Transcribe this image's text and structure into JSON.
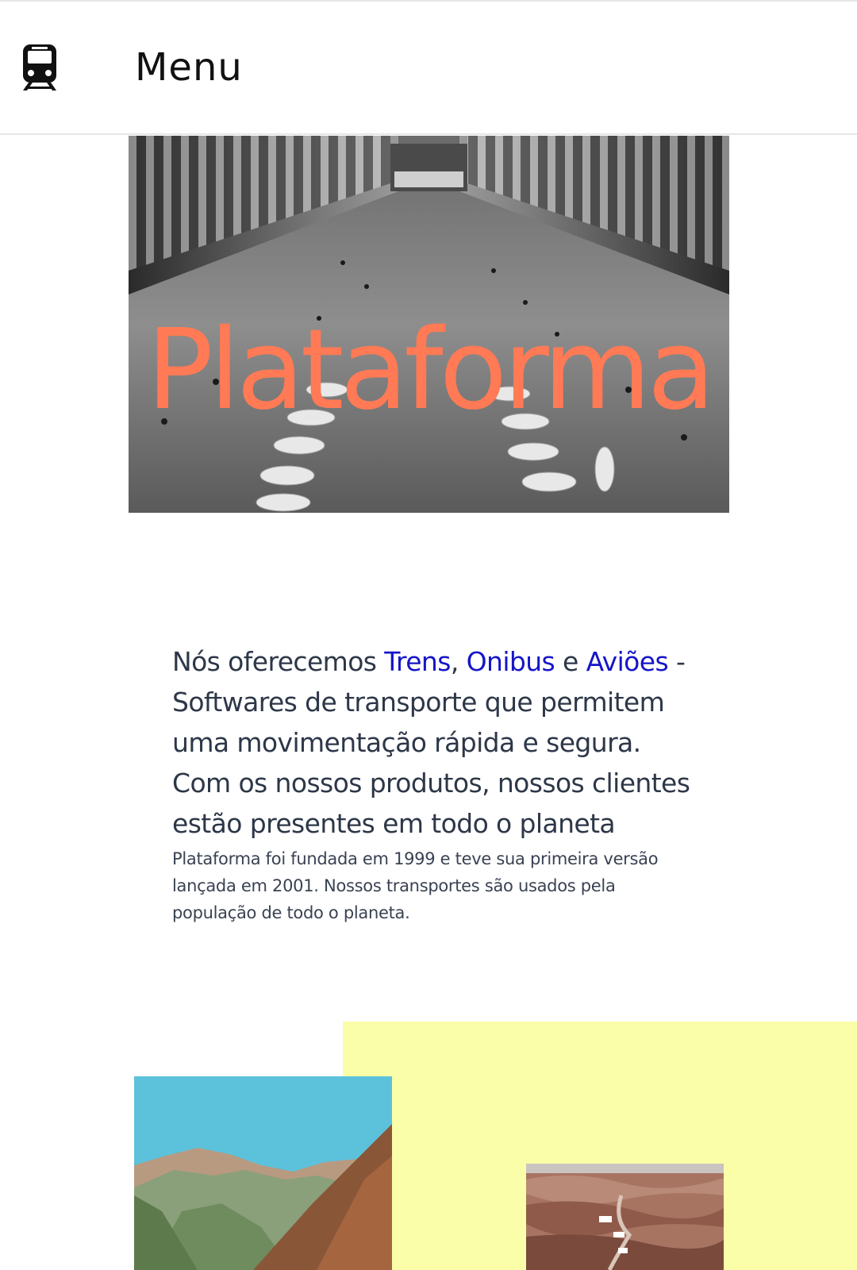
{
  "header": {
    "logo_icon": "train-icon",
    "menu_label": "Menu"
  },
  "hero": {
    "title": "Plataforma",
    "title_color": "#ff7a55",
    "image": "station-interior-photo"
  },
  "intro": {
    "heading_prefix": "Nós oferecemos ",
    "link_trains": "Trens",
    "sep1": ", ",
    "link_buses": "Onibus",
    "sep2": " e ",
    "link_planes": "Aviões",
    "heading_suffix": " - Softwares de transporte que permitem uma movimentação rápida e segura. Com os nossos produtos, nossos clientes estão presentes em todo o planeta",
    "body": "Plataforma foi fundada em 1999 e teve sua primeira versão lançada em 2001. Nossos transportes são usados pela população de todo o planeta.",
    "link_color": "#1515c8",
    "text_color": "#2d3748"
  },
  "gallery": {
    "accent_color": "#fbfea8",
    "images": [
      "mountain-valley-photo",
      "canyon-road-photo"
    ]
  }
}
